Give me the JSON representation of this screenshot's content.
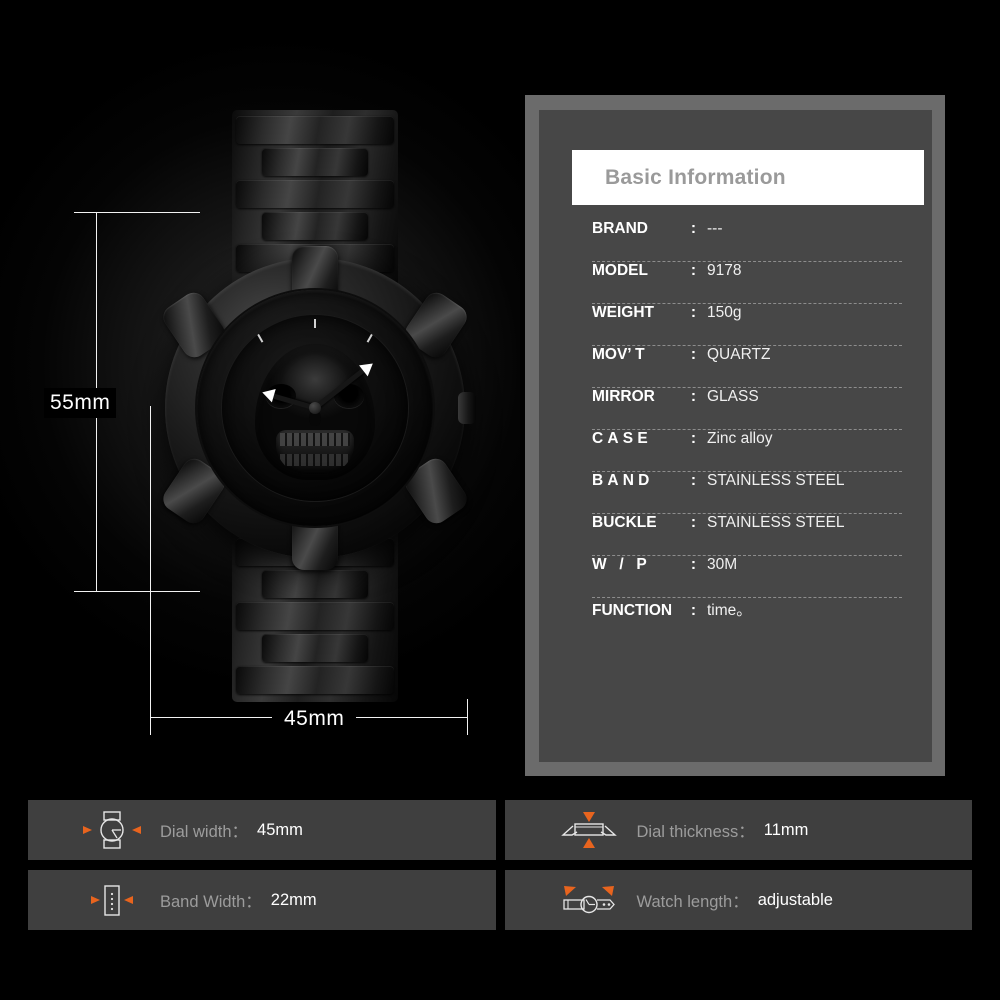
{
  "panel": {
    "header": "Basic Information",
    "specs": [
      {
        "label": "BRAND:",
        "value": "---",
        "spacing": "normal"
      },
      {
        "label": "MODEL:",
        "value": "9178",
        "spacing": "normal"
      },
      {
        "label": "WEIGHT:",
        "value": "150g",
        "spacing": "normal"
      },
      {
        "label": "MOV’ T:",
        "value": "QUARTZ",
        "spacing": "normal"
      },
      {
        "label": "MIRROR:",
        "value": "GLASS",
        "spacing": "normal"
      },
      {
        "label": "CASE:",
        "value": "Zinc alloy",
        "spacing": "wide"
      },
      {
        "label": "BAND:",
        "value": "STAINLESS STEEL",
        "spacing": "wide"
      },
      {
        "label": "BUCKLE:",
        "value": "STAINLESS STEEL",
        "spacing": "normal"
      },
      {
        "label": "W / P :",
        "value": "30M",
        "spacing": "wide"
      },
      {
        "label": "FUNCTION:",
        "value": "time。",
        "spacing": "normal"
      }
    ]
  },
  "dimensions": {
    "height_label": "55mm",
    "width_label": "45mm"
  },
  "cards": [
    {
      "icon": "watch-face-icon",
      "label": "Dial width：",
      "value": "45mm"
    },
    {
      "icon": "case-profile-icon",
      "label": "Dial thickness：",
      "value": "11mm"
    },
    {
      "icon": "band-width-icon",
      "label": "Band Width：",
      "value": "22mm"
    },
    {
      "icon": "watch-length-icon",
      "label": "Watch length：",
      "value": "adjustable"
    }
  ],
  "colors": {
    "accent": "#e8641e",
    "panel_frame": "#6b6b6b",
    "panel_body": "#474747",
    "card_bg": "#3f3f3f",
    "background": "#000000"
  }
}
